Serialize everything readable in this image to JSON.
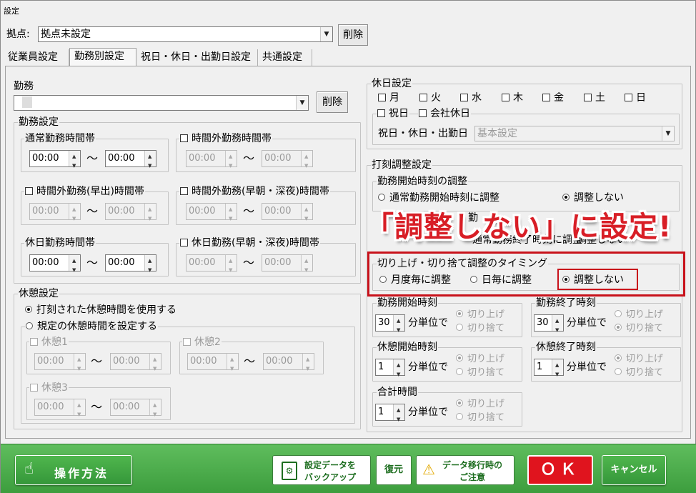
{
  "window": {
    "title": "設定"
  },
  "base": {
    "label": "拠点:",
    "value": "拠点未設定",
    "delete_label": "削除"
  },
  "tabs": [
    "従業員設定",
    "勤務別設定",
    "祝日・休日・出勤日設定",
    "共通設定"
  ],
  "work": {
    "label": "勤務",
    "value": "",
    "delete_label": "削除"
  },
  "work_settings": {
    "title": "勤務設定",
    "normal": {
      "label": "通常勤務時間帯",
      "from": "00:00",
      "to": "00:00"
    },
    "overtime": {
      "label": "時間外勤務時間帯",
      "from": "00:00",
      "to": "00:00"
    },
    "early": {
      "label": "時間外勤務(早出)時間帯",
      "from": "00:00",
      "to": "00:00"
    },
    "night": {
      "label": "時間外勤務(早朝・深夜)時間帯",
      "from": "00:00",
      "to": "00:00"
    },
    "holiday": {
      "label": "休日勤務時間帯",
      "from": "00:00",
      "to": "00:00"
    },
    "holiday_night": {
      "label": "休日勤務(早朝・深夜)時間帯",
      "from": "00:00",
      "to": "00:00"
    },
    "tilde": "〜"
  },
  "break_settings": {
    "title": "休憩設定",
    "use_stamped": "打刻された休憩時間を使用する",
    "use_rule": "規定の休憩時間を設定する",
    "break1": {
      "label": "休憩1",
      "from": "00:00",
      "to": "00:00"
    },
    "break2": {
      "label": "休憩2",
      "from": "00:00",
      "to": "00:00"
    },
    "break3": {
      "label": "休憩3",
      "from": "00:00",
      "to": "00:00"
    }
  },
  "holiday_settings": {
    "title": "休日設定",
    "days": [
      "月",
      "火",
      "水",
      "木",
      "金",
      "土",
      "日"
    ],
    "national": "祝日",
    "company": "会社休日",
    "combo_label": "祝日・休日・出勤日",
    "combo_value": "基本設定"
  },
  "stamp_settings": {
    "title": "打刻調整設定",
    "start_adjust": {
      "title": "勤務開始時刻の調整",
      "opt1": "通常勤務開始時刻に調整",
      "opt2": "調整しない",
      "opt_hidden": "勤"
    },
    "end_adjust": {
      "opt_left": "通常勤務終了時刻に調整",
      "opt_right": "調整しない"
    },
    "timing": {
      "title": "切り上げ・切り捨て調整のタイミング",
      "monthly": "月度毎に調整",
      "daily": "日毎に調整",
      "none": "調整しない"
    },
    "work_start": {
      "title": "勤務開始時刻",
      "value": "30",
      "unit": "分単位で",
      "up": "切り上げ",
      "down": "切り捨て"
    },
    "work_end": {
      "title": "勤務終了時刻",
      "value": "30",
      "unit": "分単位で",
      "up": "切り上げ",
      "down": "切り捨て"
    },
    "break_start": {
      "title": "休憩開始時刻",
      "value": "1",
      "unit": "分単位で",
      "up": "切り上げ",
      "down": "切り捨て"
    },
    "break_end": {
      "title": "休憩終了時刻",
      "value": "1",
      "unit": "分単位で",
      "up": "切り上げ",
      "down": "切り捨て"
    },
    "total": {
      "title": "合計時間",
      "value": "1",
      "unit": "分単位で",
      "up": "切り上げ",
      "down": "切り捨て"
    }
  },
  "callout": "「調整しない」に設定!",
  "footer": {
    "howto": "操作方法",
    "backup_line1": "設定データを",
    "backup_line2": "バックアップ",
    "restore": "復元",
    "migrate_line1": "データ移行時の",
    "migrate_line2": "ご注意",
    "ok": "ＯＫ",
    "cancel": "キャンセル"
  },
  "colors": {
    "accent_red": "#c8121b",
    "footer_green": "#4fb64d",
    "ok_red": "#e0141e"
  }
}
